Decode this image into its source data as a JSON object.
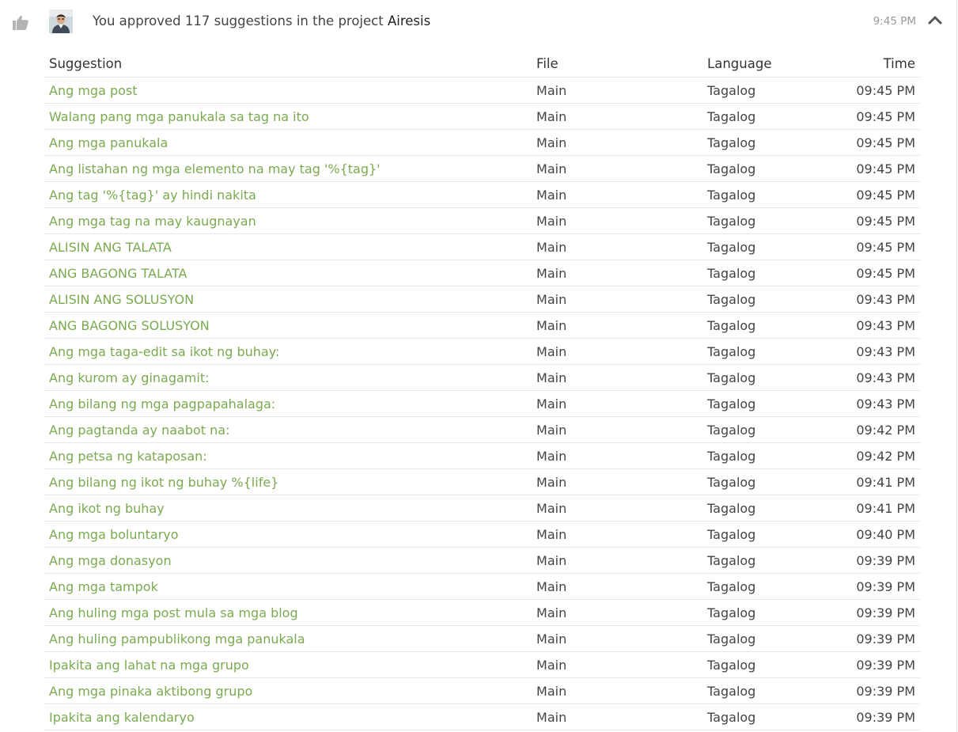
{
  "header": {
    "summary_prefix": "You approved 117 suggestions in the project",
    "project": "Airesis",
    "time": "9:45 PM"
  },
  "icons": {
    "action": "thumbs-up-icon",
    "avatar": "user-avatar",
    "collapse": "chevron-up-icon"
  },
  "colors": {
    "link": "#7aaa4f",
    "icon_gray": "#b3b3b3",
    "muted_text": "#999999"
  },
  "table": {
    "columns": [
      "Suggestion",
      "File",
      "Language",
      "Time"
    ],
    "rows": [
      {
        "suggestion": "Ang mga post",
        "file": "Main",
        "language": "Tagalog",
        "time": "09:45 PM"
      },
      {
        "suggestion": "Walang pang mga panukala sa tag na ito",
        "file": "Main",
        "language": "Tagalog",
        "time": "09:45 PM"
      },
      {
        "suggestion": "Ang mga panukala",
        "file": "Main",
        "language": "Tagalog",
        "time": "09:45 PM"
      },
      {
        "suggestion": "Ang listahan ng mga elemento na may tag '%{tag}'",
        "file": "Main",
        "language": "Tagalog",
        "time": "09:45 PM"
      },
      {
        "suggestion": "Ang tag '%{tag}' ay hindi nakita",
        "file": "Main",
        "language": "Tagalog",
        "time": "09:45 PM"
      },
      {
        "suggestion": "Ang mga tag na may kaugnayan",
        "file": "Main",
        "language": "Tagalog",
        "time": "09:45 PM"
      },
      {
        "suggestion": "ALISIN ANG TALATA",
        "file": "Main",
        "language": "Tagalog",
        "time": "09:45 PM"
      },
      {
        "suggestion": "ANG BAGONG TALATA",
        "file": "Main",
        "language": "Tagalog",
        "time": "09:45 PM"
      },
      {
        "suggestion": "ALISIN ANG SOLUSYON",
        "file": "Main",
        "language": "Tagalog",
        "time": "09:43 PM"
      },
      {
        "suggestion": "ANG BAGONG SOLUSYON",
        "file": "Main",
        "language": "Tagalog",
        "time": "09:43 PM"
      },
      {
        "suggestion": "Ang mga taga-edit sa ikot ng buhay:",
        "file": "Main",
        "language": "Tagalog",
        "time": "09:43 PM"
      },
      {
        "suggestion": "Ang kurom ay ginagamit:",
        "file": "Main",
        "language": "Tagalog",
        "time": "09:43 PM"
      },
      {
        "suggestion": "Ang bilang ng mga pagpapahalaga:",
        "file": "Main",
        "language": "Tagalog",
        "time": "09:43 PM"
      },
      {
        "suggestion": "Ang pagtanda ay naabot na:",
        "file": "Main",
        "language": "Tagalog",
        "time": "09:42 PM"
      },
      {
        "suggestion": "Ang petsa ng kataposan:",
        "file": "Main",
        "language": "Tagalog",
        "time": "09:42 PM"
      },
      {
        "suggestion": "Ang bilang ng ikot ng buhay %{life}",
        "file": "Main",
        "language": "Tagalog",
        "time": "09:41 PM"
      },
      {
        "suggestion": "Ang ikot ng buhay",
        "file": "Main",
        "language": "Tagalog",
        "time": "09:41 PM"
      },
      {
        "suggestion": "Ang mga boluntaryo",
        "file": "Main",
        "language": "Tagalog",
        "time": "09:40 PM"
      },
      {
        "suggestion": "Ang mga donasyon",
        "file": "Main",
        "language": "Tagalog",
        "time": "09:39 PM"
      },
      {
        "suggestion": "Ang mga tampok",
        "file": "Main",
        "language": "Tagalog",
        "time": "09:39 PM"
      },
      {
        "suggestion": "Ang huling mga post mula sa mga blog",
        "file": "Main",
        "language": "Tagalog",
        "time": "09:39 PM"
      },
      {
        "suggestion": "Ang huling pampublikong mga panukala",
        "file": "Main",
        "language": "Tagalog",
        "time": "09:39 PM"
      },
      {
        "suggestion": "Ipakita ang lahat na mga grupo",
        "file": "Main",
        "language": "Tagalog",
        "time": "09:39 PM"
      },
      {
        "suggestion": "Ang mga pinaka aktibong grupo",
        "file": "Main",
        "language": "Tagalog",
        "time": "09:39 PM"
      },
      {
        "suggestion": "Ipakita ang kalendaryo",
        "file": "Main",
        "language": "Tagalog",
        "time": "09:39 PM"
      }
    ]
  }
}
